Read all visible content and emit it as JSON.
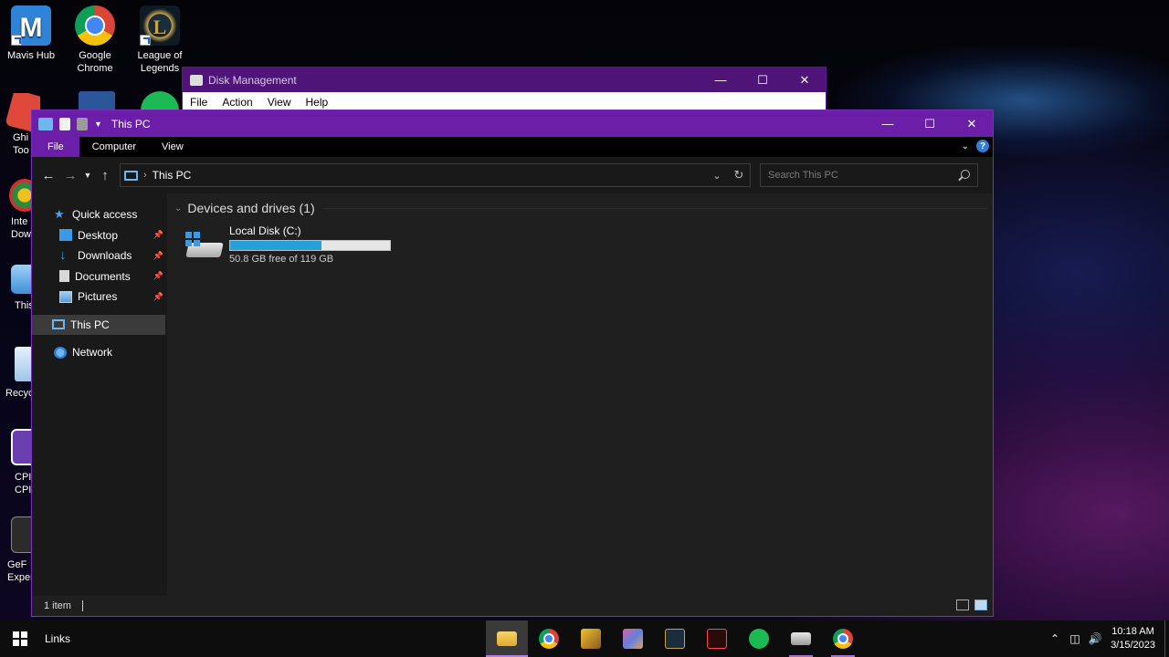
{
  "desktop": {
    "icons": [
      {
        "label": "Mavis Hub",
        "color": "#2f84d8"
      },
      {
        "label": "Google Chrome",
        "color": "#db4437"
      },
      {
        "label": "League of Legends",
        "color": "#c8a54a"
      },
      {
        "label": "Ghi Too",
        "color": "#e0483a"
      },
      {
        "label": "Inte Dow",
        "color": "#2b8a3e"
      },
      {
        "label": "This",
        "color": "#5aa0e0"
      },
      {
        "label": "Recyc",
        "color": "#7fb4e0"
      },
      {
        "label": "CPI CPI",
        "color": "#6a3fb0"
      },
      {
        "label": "GeF Exper",
        "color": "#444444"
      }
    ]
  },
  "disk_management": {
    "title": "Disk Management",
    "menu": [
      "File",
      "Action",
      "View",
      "Help"
    ]
  },
  "explorer": {
    "title": "This PC",
    "ribbon_tabs": [
      "File",
      "Computer",
      "View"
    ],
    "breadcrumb": "This PC",
    "search_placeholder": "Search This PC",
    "nav": {
      "quick_access": "Quick access",
      "desktop": "Desktop",
      "downloads": "Downloads",
      "documents": "Documents",
      "pictures": "Pictures",
      "this_pc": "This PC",
      "network": "Network"
    },
    "group_title": "Devices and drives (1)",
    "drive": {
      "name": "Local Disk (C:)",
      "free_text": "50.8 GB free of 119 GB",
      "used_fraction": 0.573
    },
    "status": "1 item"
  },
  "taskbar": {
    "links": "Links",
    "time": "10:18 AM",
    "date": "3/15/2023"
  },
  "colors": {
    "accent": "#6b1fa8",
    "drive_bar": "#26a0da"
  }
}
